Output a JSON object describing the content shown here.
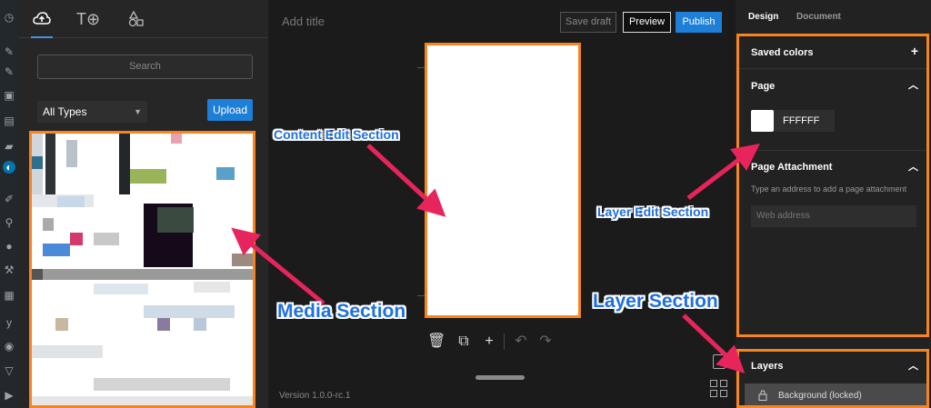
{
  "left_panel": {
    "tabs": [
      {
        "icon": "cloud-upload-icon"
      },
      {
        "icon": "text-add-icon",
        "label": "T⊕"
      },
      {
        "icon": "shapes-icon"
      }
    ],
    "search_placeholder": "Search",
    "type_select": "All Types",
    "upload_label": "Upload"
  },
  "header": {
    "title_placeholder": "Add title",
    "save_draft": "Save draft",
    "preview": "Preview",
    "publish": "Publish"
  },
  "footer": {
    "version": "Version 1.0.0-rc.1"
  },
  "right_panel": {
    "tabs": {
      "design": "Design",
      "document": "Document"
    },
    "saved_colors": "Saved colors",
    "page": {
      "title": "Page",
      "color_hex": "FFFFFF",
      "swatch_color": "#ffffff"
    },
    "attachment": {
      "title": "Page Attachment",
      "help": "Type an address to add a page attachment",
      "placeholder": "Web address"
    },
    "layers": {
      "title": "Layers",
      "item": "Background (locked)"
    }
  },
  "annotations": {
    "content_edit": "Content Edit Section",
    "media": "Media Section",
    "layer_edit": "Layer Edit Section",
    "layer": "Layer Section",
    "accent": "#f7841f",
    "arrow_color": "#e8245c",
    "text_color": "#1f70e0"
  }
}
